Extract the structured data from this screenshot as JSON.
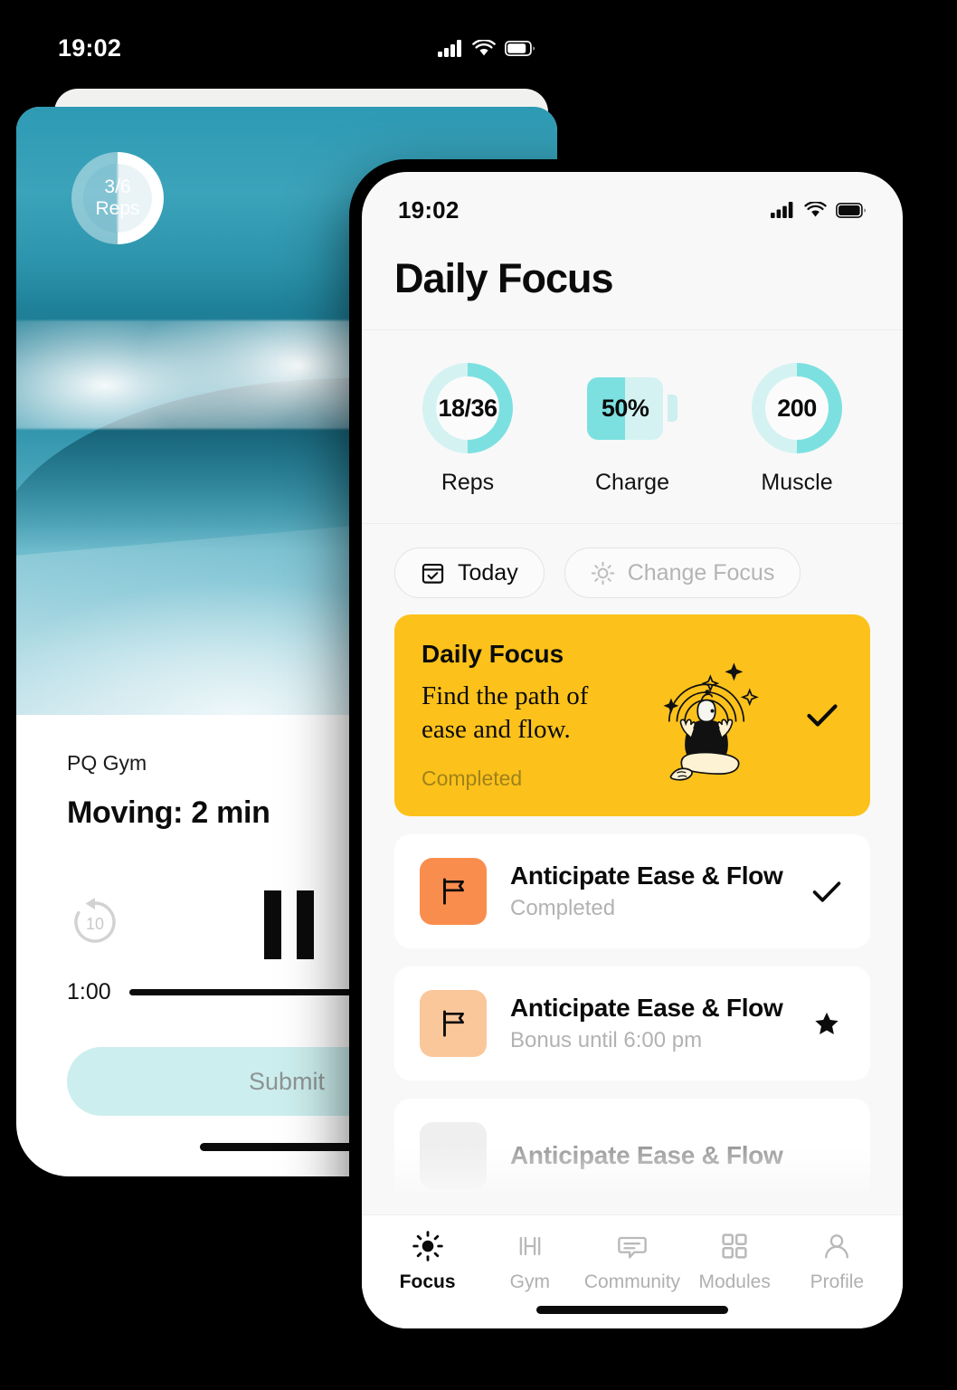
{
  "back_phone": {
    "status_bar": {
      "time": "19:02",
      "icons": [
        "signal-icon",
        "wifi-icon",
        "battery-icon"
      ]
    },
    "progress_ring": {
      "value": "3/6",
      "unit": "Reps",
      "percent": 50
    },
    "session": {
      "kicker": "PQ Gym",
      "title": "Moving: 2 min"
    },
    "controls": {
      "rewind_label": "10",
      "rewind_icon": "rewind-10-icon",
      "play_state_icon": "pause-icon",
      "elapsed": "1:00",
      "slider_percent": 73
    },
    "submit_button": {
      "label": "Submit",
      "enabled": false
    }
  },
  "front_phone": {
    "status_bar": {
      "time": "19:02",
      "icons": [
        "signal-icon",
        "wifi-icon",
        "battery-icon"
      ]
    },
    "header": {
      "title": "Daily Focus"
    },
    "stats": [
      {
        "name": "reps",
        "value": "18/36",
        "label": "Reps",
        "type": "ring",
        "percent": 50
      },
      {
        "name": "charge",
        "value": "50%",
        "label": "Charge",
        "type": "battery",
        "percent": 50
      },
      {
        "name": "muscle",
        "value": "200",
        "label": "Muscle",
        "type": "ring",
        "percent": 50
      }
    ],
    "chips": [
      {
        "label": "Today",
        "icon": "calendar-check-icon",
        "active": true
      },
      {
        "label": "Change Focus",
        "icon": "sun-icon",
        "active": false
      }
    ],
    "focus_card": {
      "title": "Daily Focus",
      "description": "Find the path of ease and flow.",
      "status": "Completed",
      "illustration": "meditation-illustration",
      "mark": "check-icon",
      "background_color": "#fcc21b"
    },
    "tasks": [
      {
        "title": "Anticipate Ease & Flow",
        "subtitle": "Completed",
        "icon": "flag-icon",
        "tile_color": "#f98d4d",
        "mark": "check-icon"
      },
      {
        "title": "Anticipate Ease & Flow",
        "subtitle": "Bonus until 6:00 pm",
        "icon": "flag-icon",
        "tile_color": "#fac79a",
        "mark": "star-icon"
      },
      {
        "title": "Anticipate Ease & Flow",
        "subtitle": "",
        "icon": "flag-icon",
        "tile_color": "#efefef",
        "mark": ""
      }
    ],
    "tabs": [
      {
        "label": "Focus",
        "icon": "sun-icon",
        "active": true
      },
      {
        "label": "Gym",
        "icon": "dumbbell-icon",
        "active": false
      },
      {
        "label": "Community",
        "icon": "chat-bubble-icon",
        "active": false
      },
      {
        "label": "Modules",
        "icon": "grid-icon",
        "active": false
      },
      {
        "label": "Profile",
        "icon": "person-icon",
        "active": false
      }
    ]
  },
  "theme": {
    "teal_dark": "#7ce0e0",
    "teal_light": "#d4f2f2",
    "yellow": "#fcc21b",
    "orange": "#f98d4d",
    "peach": "#fac79a",
    "mint": "#cdeeee"
  }
}
